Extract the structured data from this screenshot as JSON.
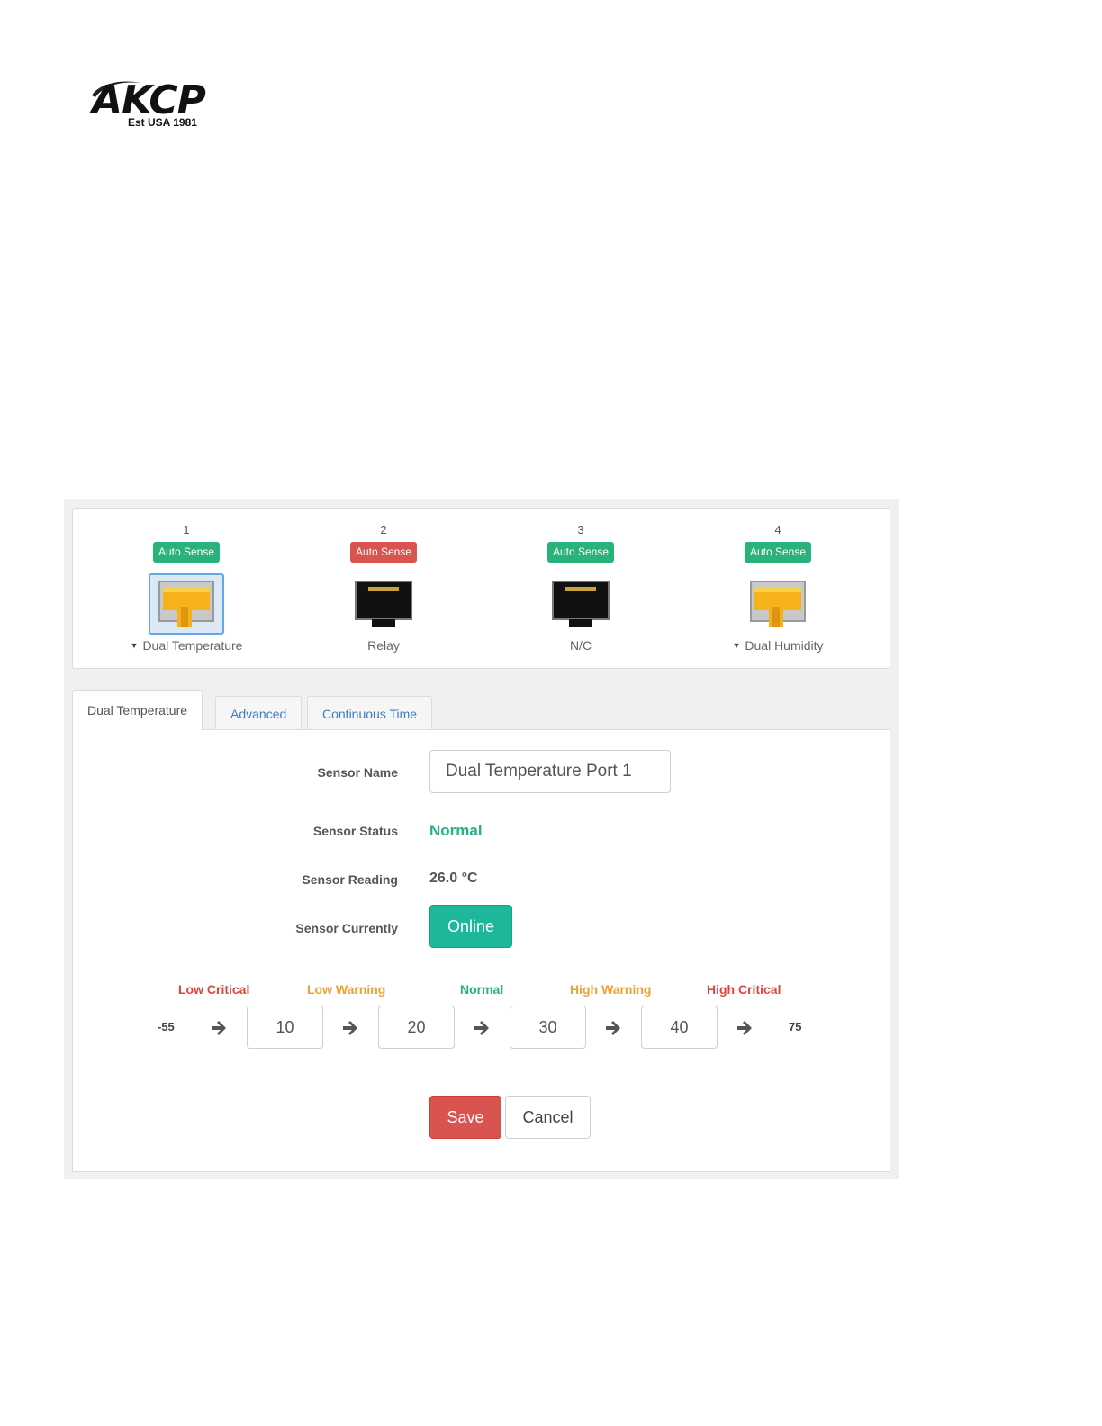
{
  "logo": {
    "name": "AKCP",
    "tagline": "Est USA 1981"
  },
  "ports": [
    {
      "number": "1",
      "badge": "Auto Sense",
      "badge_color": "#2ab27b",
      "label": "Dual Temperature",
      "icon": "rj45-connected-icon",
      "selected": true,
      "dropdown": true
    },
    {
      "number": "2",
      "badge": "Auto Sense",
      "badge_color": "#d9534f",
      "label": "Relay",
      "icon": "rj45-empty-icon",
      "selected": false,
      "dropdown": false
    },
    {
      "number": "3",
      "badge": "Auto Sense",
      "badge_color": "#2ab27b",
      "label": "N/C",
      "icon": "rj45-empty-icon",
      "selected": false,
      "dropdown": false
    },
    {
      "number": "4",
      "badge": "Auto Sense",
      "badge_color": "#2ab27b",
      "label": "Dual Humidity",
      "icon": "rj45-connected-icon",
      "selected": false,
      "dropdown": true
    }
  ],
  "tabs": [
    {
      "label": "Dual Temperature",
      "active": true
    },
    {
      "label": "Advanced",
      "active": false
    },
    {
      "label": "Continuous Time",
      "active": false
    }
  ],
  "form": {
    "sensor_name_label": "Sensor Name",
    "sensor_name_value": "Dual Temperature Port 1",
    "sensor_status_label": "Sensor Status",
    "sensor_status_value": "Normal",
    "sensor_reading_label": "Sensor Reading",
    "sensor_reading_value": "26.0 °C",
    "sensor_currently_label": "Sensor Currently",
    "sensor_currently_value": "Online"
  },
  "thresholds": {
    "labels": [
      {
        "text": "Low Critical",
        "color": "#e0453d"
      },
      {
        "text": "Low Warning",
        "color": "#f0a030"
      },
      {
        "text": "Normal",
        "color": "#26b08a"
      },
      {
        "text": "High Warning",
        "color": "#f0a030"
      },
      {
        "text": "High Critical",
        "color": "#e0453d"
      }
    ],
    "min": "-55",
    "max": "75",
    "values": [
      "10",
      "20",
      "30",
      "40"
    ]
  },
  "actions": {
    "save": "Save",
    "cancel": "Cancel"
  }
}
